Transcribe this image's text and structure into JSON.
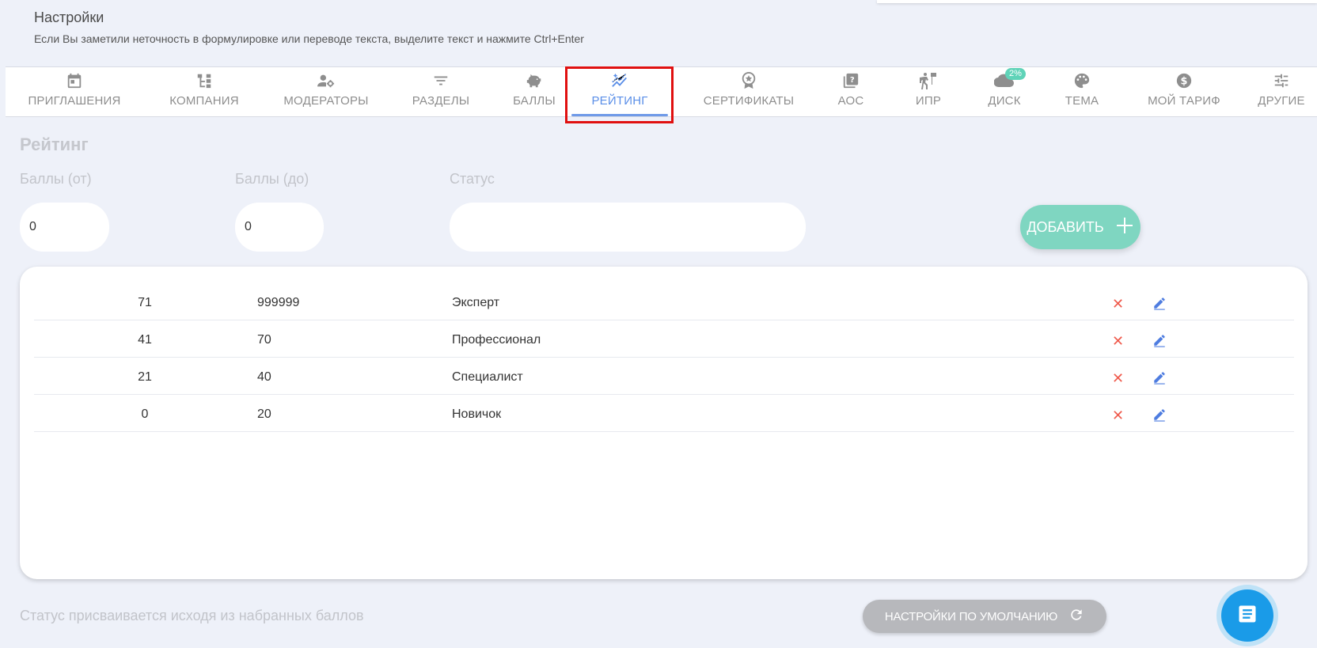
{
  "header": {
    "title": "Настройки",
    "hint": "Если Вы заметили неточность в формулировке или переводе текста, выделите текст и нажмите Ctrl+Enter"
  },
  "tabs": [
    {
      "label": "ПРИГЛАШЕНИЯ",
      "icon": "calendar-icon"
    },
    {
      "label": "КОМПАНИЯ",
      "icon": "org-structure-icon"
    },
    {
      "label": "МОДЕРАТОРЫ",
      "icon": "user-gear-icon"
    },
    {
      "label": "РАЗДЕЛЫ",
      "icon": "filter-icon"
    },
    {
      "label": "БАЛЛЫ",
      "icon": "piggy-bank-icon"
    },
    {
      "label": "РЕЙТИНГ",
      "icon": "sparkle-chart-icon",
      "active": true
    },
    {
      "label": "СЕРТИФИКАТЫ",
      "icon": "award-icon"
    },
    {
      "label": "АОС",
      "icon": "quiz-icon"
    },
    {
      "label": "ИПР",
      "icon": "steps-icon"
    },
    {
      "label": "ДИСК",
      "icon": "cloud-icon",
      "badge": "2%"
    },
    {
      "label": "ТЕМА",
      "icon": "palette-icon"
    },
    {
      "label": "МОЙ ТАРИФ",
      "icon": "dollar-icon"
    },
    {
      "label": "ДРУГИЕ",
      "icon": "sliders-icon"
    }
  ],
  "rating": {
    "section_title": "Рейтинг",
    "points_from_label": "Баллы (от)",
    "points_to_label": "Баллы (до)",
    "status_label": "Статус",
    "points_from_value": "0",
    "points_to_value": "0",
    "status_value": "",
    "add_button_label": "ДОБАВИТЬ",
    "rows": [
      {
        "from": "71",
        "to": "999999",
        "status": "Эксперт"
      },
      {
        "from": "41",
        "to": "70",
        "status": "Профессионал"
      },
      {
        "from": "21",
        "to": "40",
        "status": "Специалист"
      },
      {
        "from": "0",
        "to": "20",
        "status": "Новичок"
      }
    ],
    "footer_note": "Статус присваивается исходя из набранных баллов",
    "defaults_button_label": "НАСТРОЙКИ ПО УМОЛЧАНИЮ"
  },
  "colors": {
    "accent_blue": "#5b8fe8",
    "add_button": "#7fd6c1",
    "delete_red": "#ef5a4c",
    "highlight_red": "#e01010",
    "fab_blue": "#1a9be8"
  }
}
